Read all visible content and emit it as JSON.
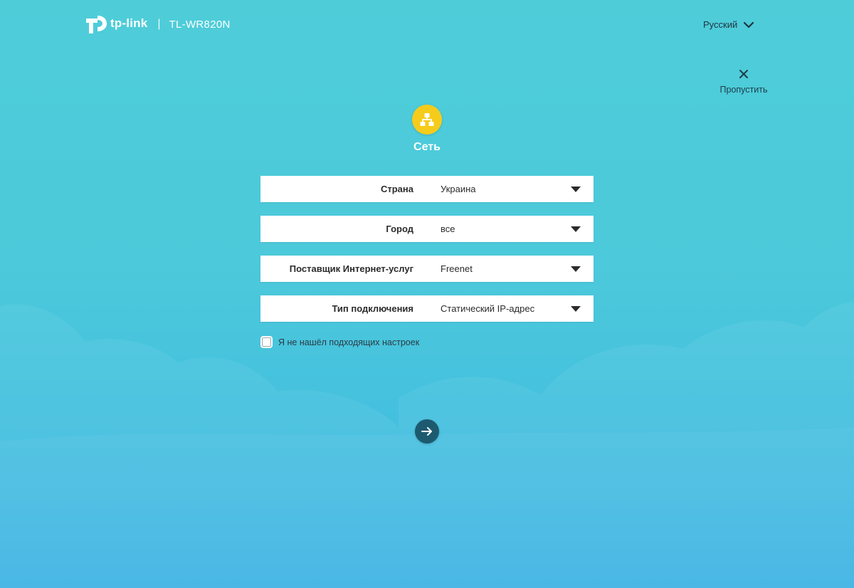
{
  "header": {
    "brand": "tp-link",
    "separator": "|",
    "model": "TL-WR820N",
    "language": "Русский"
  },
  "skip": {
    "label": "Пропустить"
  },
  "step": {
    "title": "Сеть",
    "icon": "network-icon",
    "icon_color": "#f5cc1b"
  },
  "form": {
    "fields": [
      {
        "label": "Страна",
        "value": "Украина"
      },
      {
        "label": "Город",
        "value": "все"
      },
      {
        "label": "Поставщик Интернет-услуг",
        "value": "Freenet"
      },
      {
        "label": "Тип подключения",
        "value": "Статический IP-адрес"
      }
    ],
    "checkbox_label": "Я не нашёл подходящих настроек",
    "checkbox_checked": false
  },
  "actions": {
    "next_icon": "arrow-right-icon",
    "next_color": "#1d5a70"
  },
  "colors": {
    "background_top": "#4ecdd9",
    "background_bottom": "#38b1e3"
  }
}
